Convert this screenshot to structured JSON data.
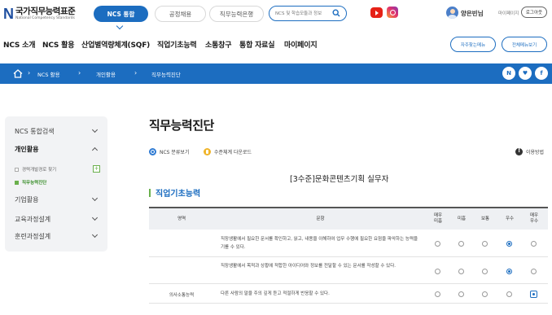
{
  "logo": {
    "title": "국가직무능력표준",
    "subtitle": "National Competency Standards"
  },
  "top_tabs": [
    "NCS 통합",
    "공정채용",
    "직무능력은행"
  ],
  "search": {
    "placeholder": "NCS 및 학습모듈과 정보"
  },
  "user": {
    "name": "양은빈님",
    "mypage": "마이페이지",
    "logout": "로그아웃"
  },
  "nav": {
    "items": [
      "NCS 소개",
      "NCS 활용",
      "산업별역량체계(SQF)",
      "직업기초능력",
      "소통창구",
      "통합 자료실",
      "마이페이지"
    ],
    "favorites": "자주찾는메뉴",
    "all_menu": "전체메뉴보기"
  },
  "breadcrumb": [
    "NCS 활용",
    "개인활용",
    "직무능력진단"
  ],
  "breadcrumb_buttons": [
    "N",
    "♥",
    "f"
  ],
  "sidebar": {
    "items": [
      "NCS 통합검색",
      "개인활용",
      "기업활용",
      "교육과정설계",
      "훈련과정설계"
    ],
    "sub_items": [
      "경력개발경로 찾기",
      "직무능력진단"
    ]
  },
  "page_title": "직무능력진단",
  "tools": {
    "classification": "NCS 분류보기",
    "level_download": "수준체계 다운로드",
    "usage": "이용방법"
  },
  "level_title": "[3수준]문화콘텐츠기획 실무자",
  "section_title": "직업기초능력",
  "table": {
    "headers": {
      "domain": "영역",
      "question": "문항",
      "scale": [
        "매우\n미흡",
        "미흡",
        "보통",
        "우수",
        "매우\n우수"
      ]
    },
    "domain_label": "의사소통능력",
    "rows": [
      {
        "question": "직장생활에서 필요한 문서를 확인하고, 읽고, 내용을 이해하여 업무 수행에 필요한 요점을 파악하는 능력을 기를 수 있다.",
        "selected": 3
      },
      {
        "question": "직장생활에서 목적과 상황에 적합한 아이디어와 정보를 전달할 수 있는 문서를 작성할 수 있다.",
        "selected": 3
      },
      {
        "question": "다른 사람의 말을 주의 깊게 듣고 적절하게 반응할 수 있다.",
        "selected": 4
      }
    ]
  },
  "colors": {
    "brand": "#1c6dc0",
    "accent_green": "#6ab04c"
  }
}
